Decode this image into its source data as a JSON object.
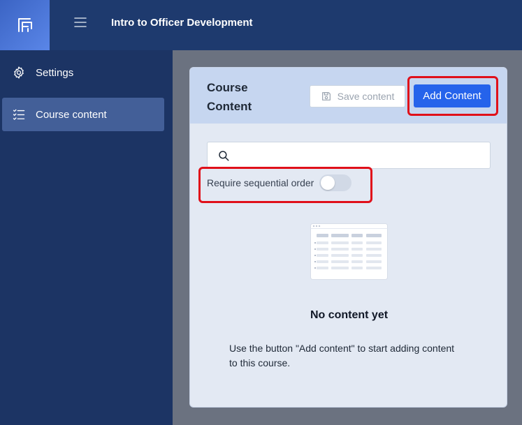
{
  "header": {
    "title": "Intro to Officer Development"
  },
  "sidebar": {
    "items": [
      {
        "label": "Settings",
        "icon": "gear-icon"
      },
      {
        "label": "Course content",
        "icon": "list-check-icon",
        "active": true
      }
    ]
  },
  "card": {
    "title": "Course Content",
    "save_label": "Save content",
    "add_label": "Add Content",
    "search_placeholder": "",
    "sequential_label": "Require sequential order",
    "sequential_on": false,
    "empty_title": "No content yet",
    "empty_desc": "Use the button \"Add content\" to start adding content to this course."
  },
  "colors": {
    "topbar": "#1e3a6e",
    "sidebar": "#1c3464",
    "accent": "#2563eb",
    "highlight": "#e0101a"
  }
}
